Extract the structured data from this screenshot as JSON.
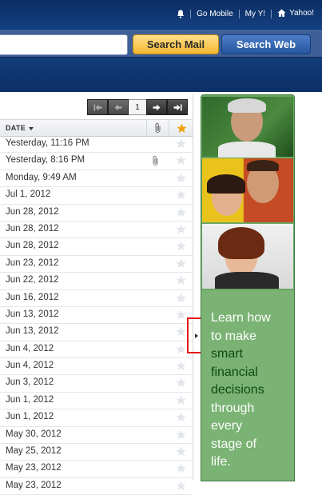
{
  "header": {
    "go_mobile": "Go Mobile",
    "my_y": "My Y!",
    "yahoo": "Yahoo!"
  },
  "search": {
    "mail_label": "Search Mail",
    "web_label": "Search Web",
    "value": ""
  },
  "pager": {
    "page": "1"
  },
  "list": {
    "date_header": "DATE",
    "rows": [
      {
        "date": "Yesterday, 11:16 PM",
        "attachment": false
      },
      {
        "date": "Yesterday, 8:16 PM",
        "attachment": true
      },
      {
        "date": "Monday, 9:49 AM",
        "attachment": false
      },
      {
        "date": "Jul 1, 2012",
        "attachment": false
      },
      {
        "date": "Jun 28, 2012",
        "attachment": false
      },
      {
        "date": "Jun 28, 2012",
        "attachment": false
      },
      {
        "date": "Jun 28, 2012",
        "attachment": false
      },
      {
        "date": "Jun 23, 2012",
        "attachment": false
      },
      {
        "date": "Jun 22, 2012",
        "attachment": false
      },
      {
        "date": "Jun 16, 2012",
        "attachment": false
      },
      {
        "date": "Jun 13, 2012",
        "attachment": false
      },
      {
        "date": "Jun 13, 2012",
        "attachment": false
      },
      {
        "date": "Jun 4, 2012",
        "attachment": false
      },
      {
        "date": "Jun 4, 2012",
        "attachment": false
      },
      {
        "date": "Jun 3, 2012",
        "attachment": false
      },
      {
        "date": "Jun 1, 2012",
        "attachment": false
      },
      {
        "date": "Jun 1, 2012",
        "attachment": false
      },
      {
        "date": "May 30, 2012",
        "attachment": false
      },
      {
        "date": "May 25, 2012",
        "attachment": false
      },
      {
        "date": "May 23, 2012",
        "attachment": false
      },
      {
        "date": "May 23, 2012",
        "attachment": false
      }
    ]
  },
  "ad": {
    "line1": "Learn how",
    "line2": "to make",
    "line3": "smart",
    "line4": "financial",
    "line5": "decisions",
    "line6": "through",
    "line7": "every",
    "line8": "stage of",
    "line9": "life."
  },
  "colors": {
    "header_bg": "#0f3670",
    "search_mail_button": "#f7b731",
    "search_web_button": "#25569f",
    "star_header": "#f0a30a",
    "ad_green": "#6aa865",
    "highlight_box": "#e01a1a"
  }
}
